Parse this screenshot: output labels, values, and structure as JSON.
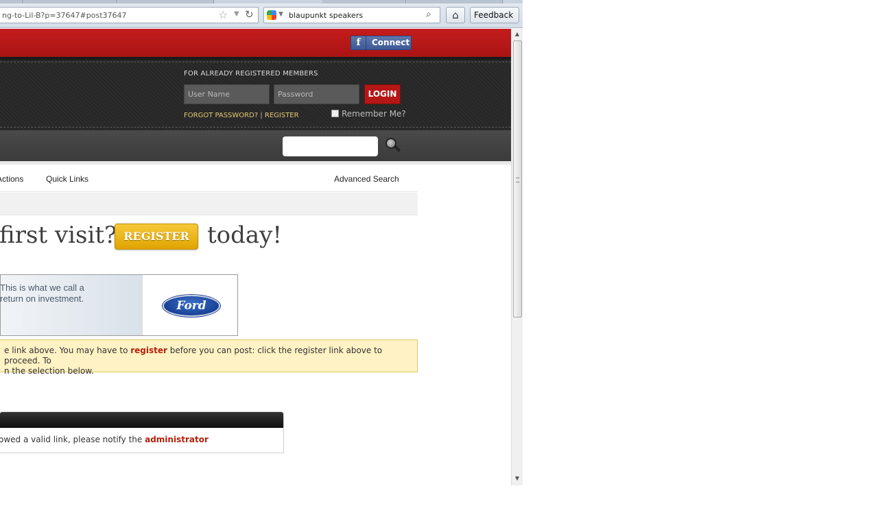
{
  "browser": {
    "url": "ng-to-Lil-B?p=37647#post37647",
    "search_query": "blaupunkt speakers",
    "feedback_label": "Feedback",
    "icons": {
      "bookmark": "star-icon",
      "dropdown": "chevron-down-icon",
      "reload": "reload-icon",
      "engine": "google-icon",
      "search": "magnifier-icon",
      "home": "home-icon"
    }
  },
  "header": {
    "facebook_connect_label": "Connect",
    "login_heading": "FOR ALREADY REGISTERED MEMBERS",
    "username_placeholder": "User Name",
    "password_placeholder": "Password",
    "login_label": "LOGIN",
    "forgot_label": "FORGOT PASSWORD?",
    "separator": "|",
    "register_label": "REGISTER",
    "remember_label": "Remember Me?"
  },
  "nav": {
    "actions_label": "Actions",
    "quick_links_label": "Quick Links",
    "advanced_search_label": "Advanced Search"
  },
  "welcome": {
    "prefix": "r first visit?",
    "register_button": "REGISTER",
    "suffix": "today!"
  },
  "ad": {
    "line1": "This is what we call a",
    "line2": "return on investment.",
    "logo_text": "Ford"
  },
  "notice": {
    "line1_before": "e link above. You may have to ",
    "register_link": "register",
    "line1_after": " before you can post: click the register link above to proceed. To",
    "line2": "n the selection below."
  },
  "error": {
    "message_before": "owed a valid link, please notify the ",
    "admin_link": "administrator"
  },
  "colors": {
    "brand_red": "#b51717",
    "register_gold": "#e0a400",
    "notice_bg": "#fff2c4",
    "link_red": "#b5200b",
    "facebook_blue": "#3b5998"
  }
}
